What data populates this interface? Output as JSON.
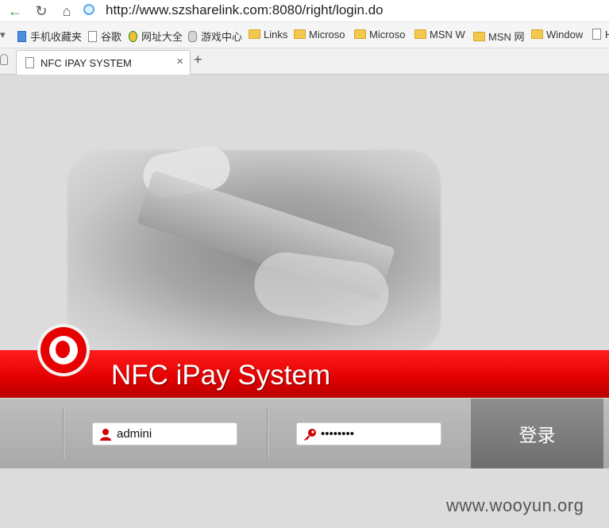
{
  "browser": {
    "url": "http://www.szsharelink.com:8080/right/login.do",
    "bookmarks": [
      "手机收藏夹",
      "谷歌",
      "网址大全",
      "游戏中心",
      "Links",
      "Microso",
      "Microso",
      "MSN W",
      "MSN 网",
      "Window",
      "H"
    ],
    "tab": {
      "title": "NFC IPAY SYSTEM",
      "close": "×"
    },
    "new_tab": "+"
  },
  "page": {
    "banner_title": "NFC iPay System",
    "username_value": "admini",
    "password_value": "••••••••",
    "login_button": "登录",
    "watermark": "www.wooyun.org"
  },
  "colors": {
    "brand_red": "#e60000",
    "login_button": "#7c7c7c"
  }
}
